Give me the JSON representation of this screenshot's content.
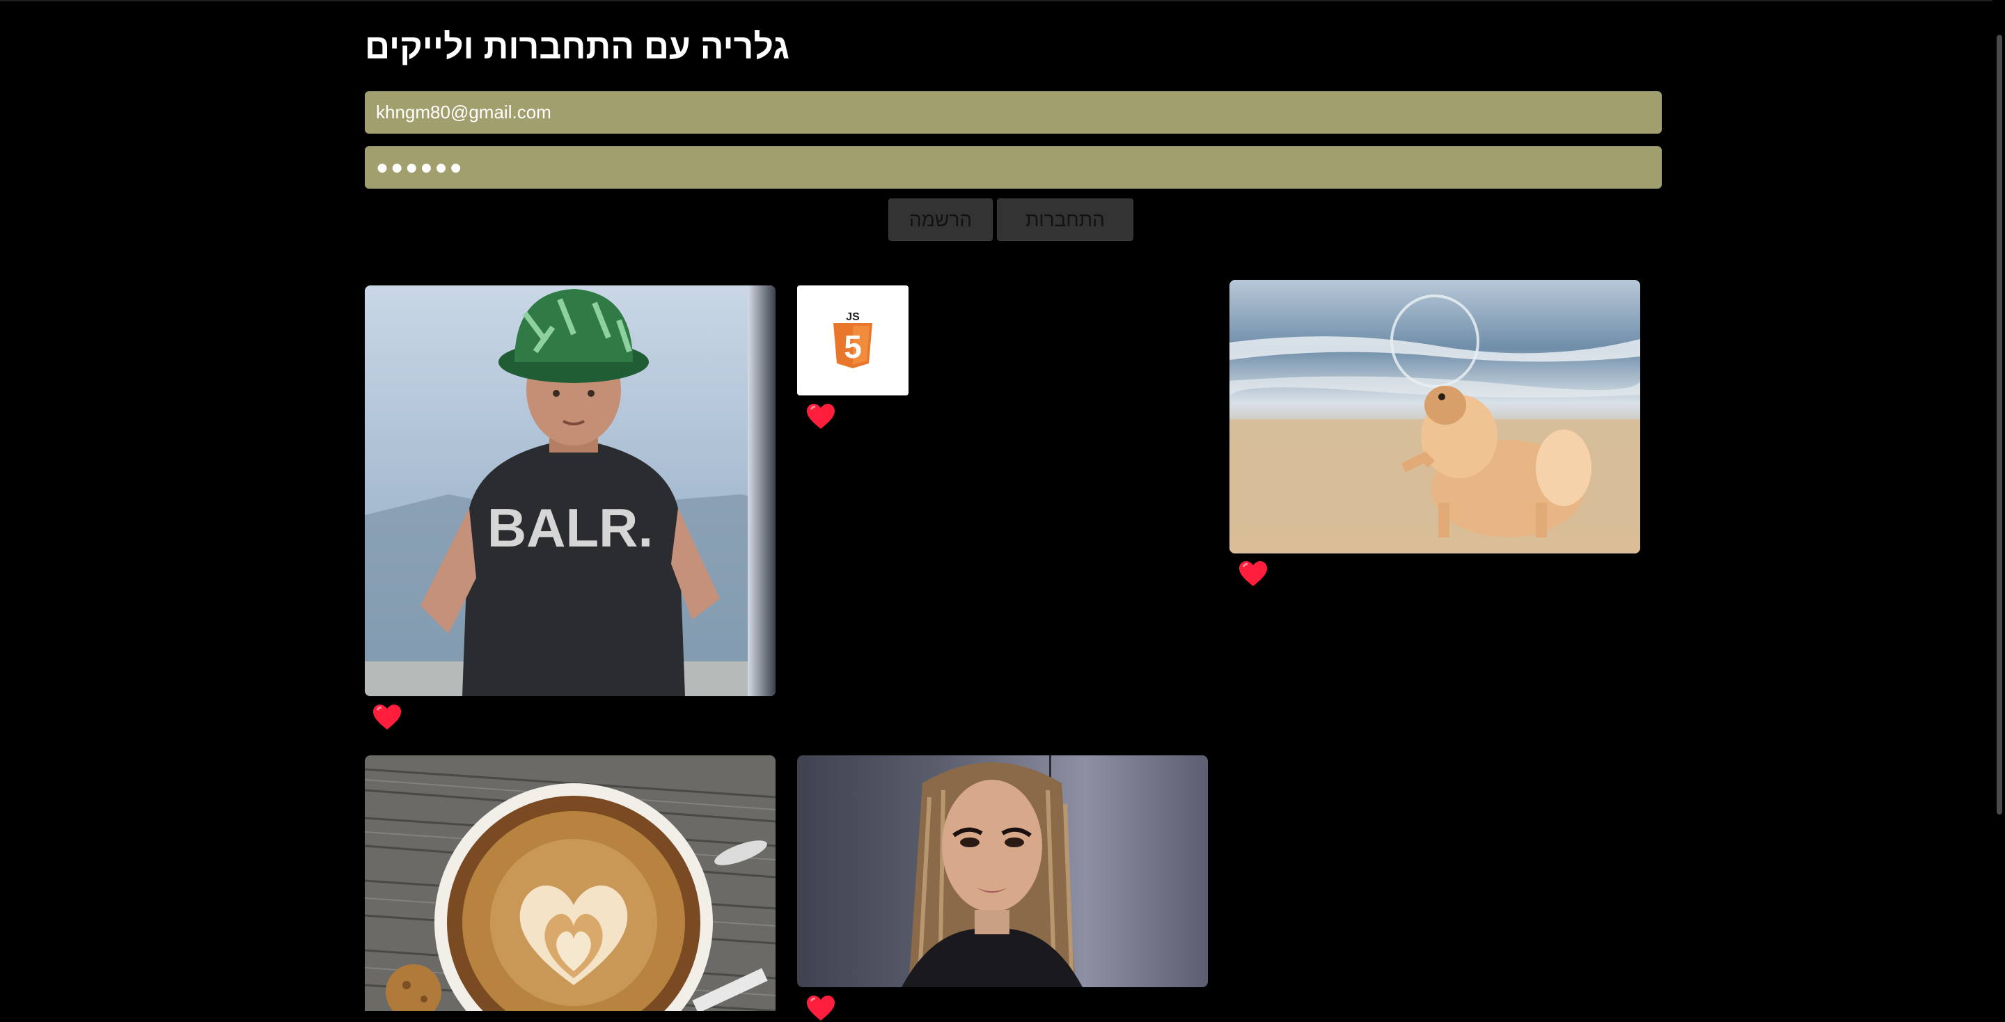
{
  "page": {
    "title": "גלריה עם התחברות ולייקים"
  },
  "auth": {
    "email_value": "khngm80@gmail.com",
    "password_value": "●●●●●●",
    "register_label": "הרשמה",
    "login_label": "התחברות"
  },
  "gallery": {
    "items": [
      {
        "subject": "man-in-bucket-hat-balr-shirt",
        "shirt_text": "BALR.",
        "liked": true
      },
      {
        "subject": "javascript-logo",
        "logo_text": "JS",
        "logo_mark": "5",
        "liked": true
      },
      {
        "subject": "pomeranian-dog-on-beach-with-bubble",
        "liked": true
      },
      {
        "subject": "latte-art-coffee-cup",
        "liked": false
      },
      {
        "subject": "woman-portrait-braided-hair",
        "liked": true
      }
    ]
  },
  "colors": {
    "background": "#000000",
    "input_bg": "#a19f6d",
    "button_bg": "#333333",
    "heart": "#ff1f3d",
    "js_orange": "#e8762b"
  },
  "icons": {
    "like": "heart-icon"
  }
}
